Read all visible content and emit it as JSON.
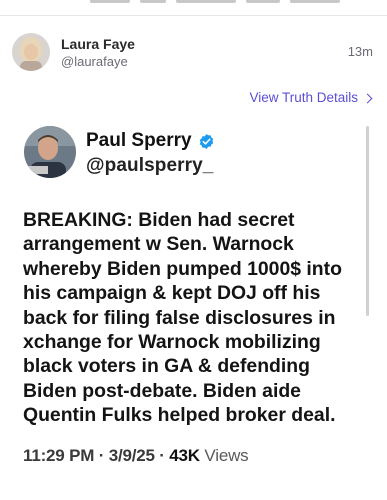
{
  "truth": {
    "author_name": "Laura Faye",
    "author_handle": "@laurafaye",
    "time": "13m",
    "view_details": "View Truth Details"
  },
  "embedded_tweet": {
    "name": "Paul Sperry",
    "handle": "@paulsperry_",
    "text_lines": [
      "BREAKING: Biden had secret",
      "arrangement w Sen. Warnock",
      "whereby Biden pumped 1000$ into",
      "his campaign & kept DOJ off his",
      "back for filing false disclosures in",
      "xchange for Warnock mobilizing",
      "black voters in GA & defending",
      "Biden post-debate. Biden aide",
      "Quentin Fulks helped broker deal."
    ],
    "time": "11:29 PM",
    "date": "3/9/25",
    "views_count": "43K",
    "views_label": "Views"
  },
  "colors": {
    "link_purple": "#5b4fd6",
    "verified_blue": "#1d9bf0"
  }
}
